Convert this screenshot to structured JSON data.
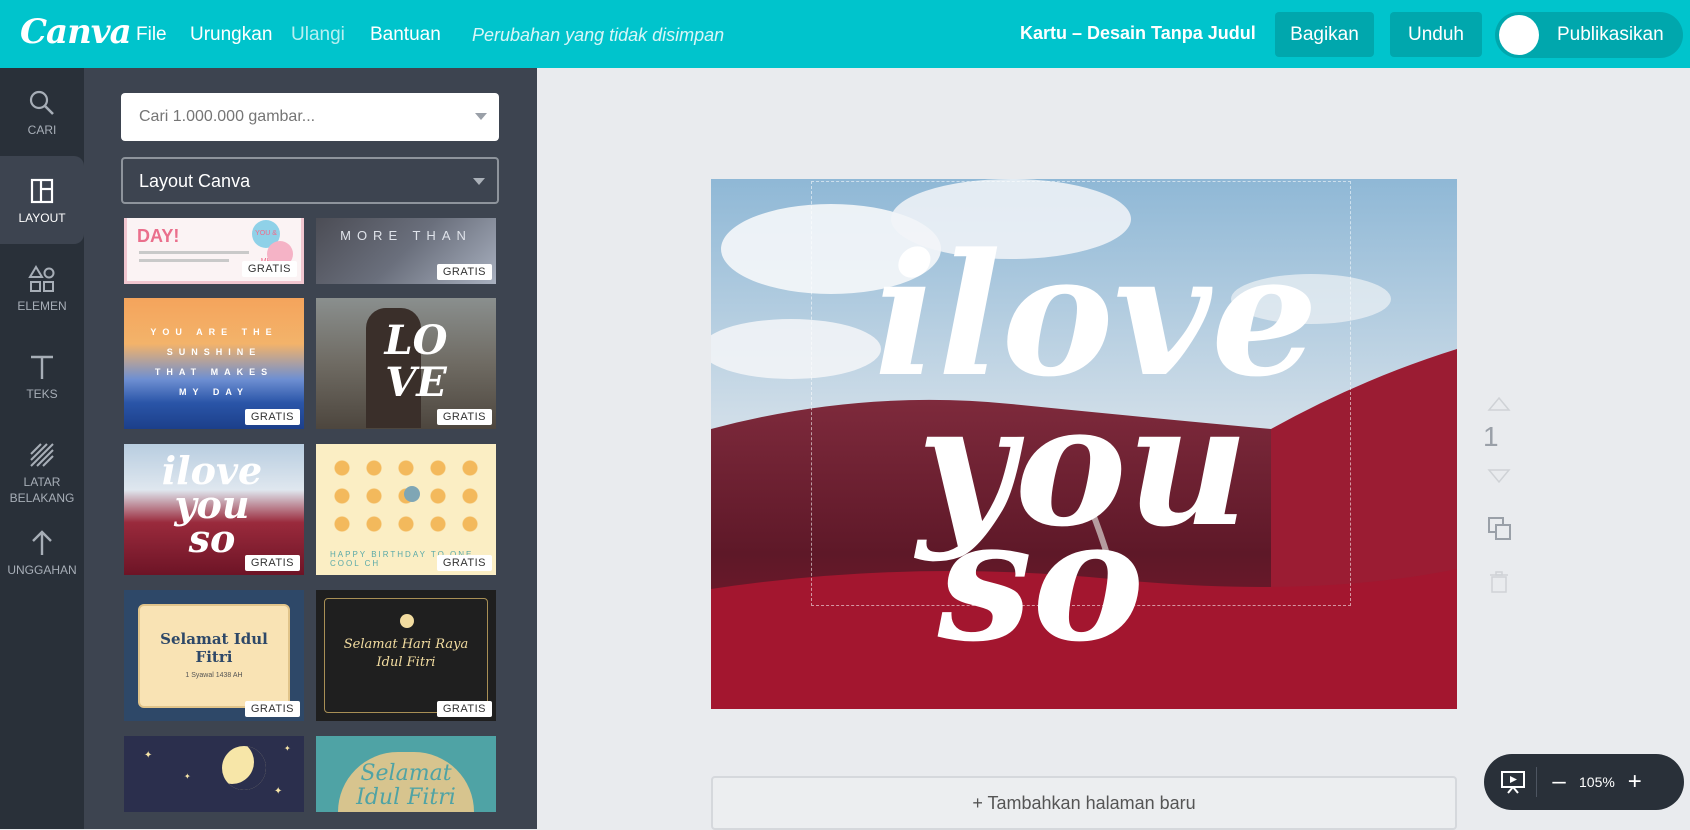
{
  "topbar": {
    "logo": "Canva",
    "menu": {
      "file": "File",
      "undo": "Urungkan",
      "redo": "Ulangi",
      "help": "Bantuan"
    },
    "status": "Perubahan yang tidak disimpan",
    "doc_title": "Kartu – Desain Tanpa Judul",
    "share": "Bagikan",
    "download": "Unduh",
    "publish": "Publikasikan"
  },
  "rail": {
    "items": [
      {
        "label": "CARI",
        "icon": "search-icon"
      },
      {
        "label": "LAYOUT",
        "icon": "layout-icon"
      },
      {
        "label": "ELEMEN",
        "icon": "shapes-icon"
      },
      {
        "label": "TEKS",
        "icon": "text-icon"
      },
      {
        "label": "LATAR BELAKANG",
        "icon": "background-icon"
      },
      {
        "label": "UNGGAHAN",
        "icon": "upload-icon"
      }
    ]
  },
  "panel": {
    "search_placeholder": "Cari 1.000.000 gambar...",
    "category": "Layout Canva",
    "badge": "GRATIS",
    "tiles": [
      {
        "text": "DAY!",
        "text2": "YOU & ME"
      },
      {
        "text": "MORE THAN"
      },
      {
        "text": "YOU ARE THE SUNSHINE THAT MAKES MY DAY"
      },
      {
        "text": "LO VE"
      },
      {
        "text": "ilove you so"
      },
      {
        "text": "HAPPY BIRTHDAY TO ONE COOL CH"
      },
      {
        "text": "Selamat Idul Fitri",
        "sub": "1 Syawal 1438 AH"
      },
      {
        "text": "Selamat Hari Raya Idul Fitri"
      },
      {
        "text": ""
      },
      {
        "text": "Selamat Idul Fitri"
      }
    ]
  },
  "canvas": {
    "art_text": [
      "ilove",
      "you",
      "so"
    ],
    "page_number": "1",
    "add_page": "+ Tambahkan halaman baru",
    "zoom": "105%",
    "zoom_minus": "–",
    "zoom_plus": "+"
  },
  "colors": {
    "brand": "#00c4cc",
    "brand_dark": "#00a7ad",
    "rail": "#293039",
    "panel": "#3d4450"
  }
}
